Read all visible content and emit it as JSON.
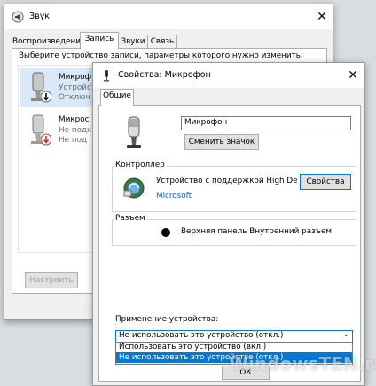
{
  "sound": {
    "title": "Звук",
    "tabs": [
      "Воспроизведение",
      "Запись",
      "Звуки",
      "Связь"
    ],
    "instruction": "Выберите устройство записи, параметры которого нужно изменить:",
    "devices": [
      {
        "name": "Микроф",
        "sub1": "Устройст",
        "sub2": "Отключ"
      },
      {
        "name": "Микрос",
        "sub1": "Не подк",
        "sub2": "Не под"
      }
    ],
    "configure_label": "Настроить"
  },
  "props": {
    "title": "Свойства: Микрофон",
    "tab": "Общие",
    "name_value": "Микрофон",
    "change_icon_label": "Сменить значок",
    "controller_label": "Контроллер",
    "controller_name": "Устройство с поддержкой High Defi...",
    "controller_vendor": "Microsoft",
    "properties_label": "Свойства",
    "jack_label": "Разъем",
    "jack_info": "Верхняя панель Внутренний разъем",
    "usage_label": "Применение устройства:",
    "usage_selected": "Не использовать это устройство (откл.)",
    "usage_options": [
      "Использовать это устройство (вкл.)",
      "Не использовать это устройство (откл.)"
    ],
    "ok_label": "ОК"
  },
  "watermark": "WindowsTEN.ru",
  "colors": {
    "accent": "#0078d7",
    "jack_dot": "#000000",
    "disabled_arrow": "#d32f2f"
  }
}
